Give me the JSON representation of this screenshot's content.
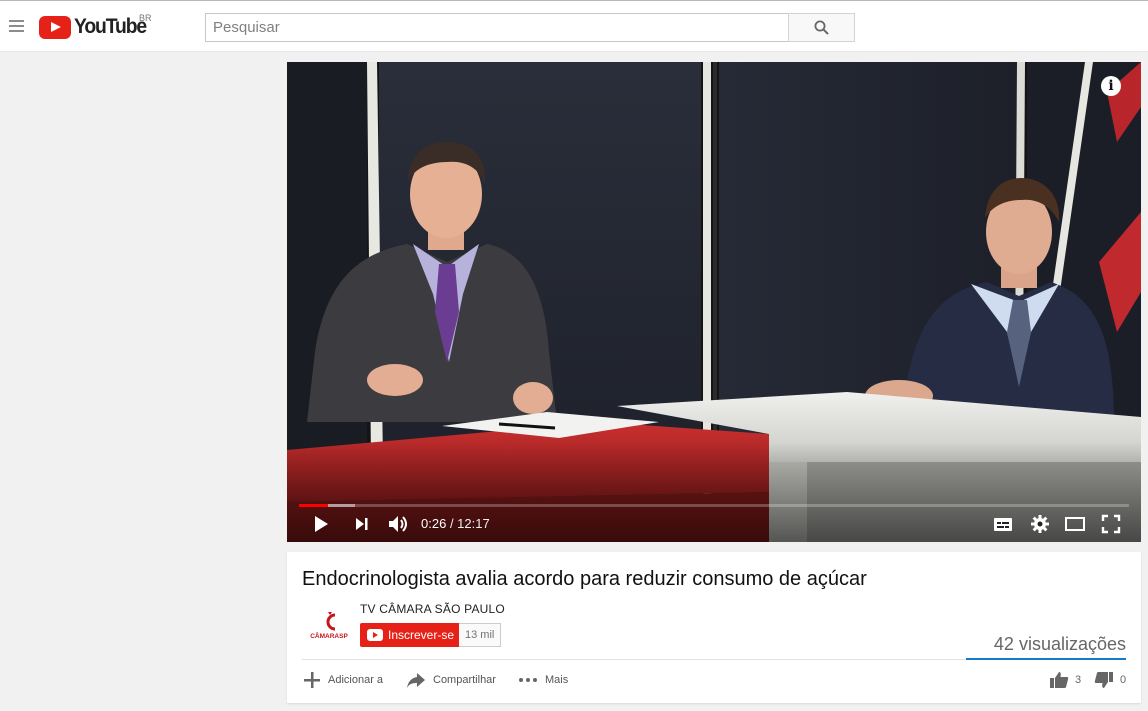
{
  "masthead": {
    "logo_text": "YouTube",
    "country": "BR",
    "search_placeholder": "Pesquisar"
  },
  "player": {
    "current_time": "0:26",
    "duration": "12:17",
    "played_fraction": 0.035,
    "loaded_fraction": 0.068,
    "accent_color": "#ff0000"
  },
  "video": {
    "title": "Endocrinologista avalia acordo para reduzir consumo de açúcar",
    "views": "42 visualizações",
    "likes": "3",
    "dislikes": "0"
  },
  "channel": {
    "name": "TV CÂMARA SÃO PAULO",
    "logo_text": "CÂMARASP",
    "subscribe_label": "Inscrever-se",
    "subscriber_count": "13 mil"
  },
  "actions": {
    "add_to": "Adicionar a",
    "share": "Compartilhar",
    "more": "Mais"
  },
  "colors": {
    "brand_red": "#e62117",
    "link_blue": "#167ac6"
  }
}
